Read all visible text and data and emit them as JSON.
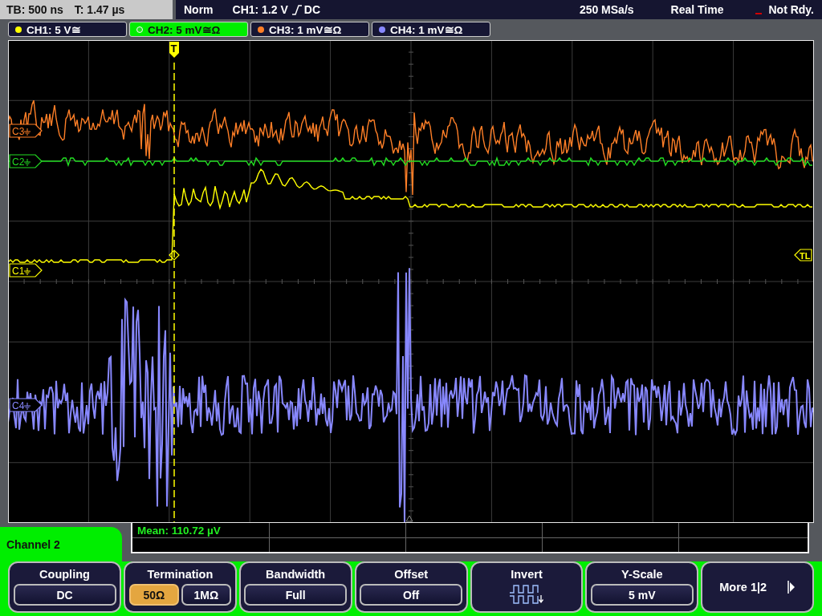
{
  "status_bar": {
    "timebase": "TB: 500 ns",
    "trigger_time": "T: 1.47 µs",
    "trigger_mode": "Norm",
    "trigger_source": "CH1: 1.2 V",
    "trigger_coupling": "DC",
    "sample_rate": "250 MSa/s",
    "acquisition": "Real Time",
    "state": "Not Rdy."
  },
  "channels": [
    {
      "label": "CH1: 5 V≅",
      "color": "#ffff00",
      "selected": false
    },
    {
      "label": "CH2: 5 mV≅Ω",
      "color": "#22dd22",
      "selected": true
    },
    {
      "label": "CH3: 1 mV≅Ω",
      "color": "#ff7f27",
      "selected": false
    },
    {
      "label": "CH4: 1 mV≅Ω",
      "color": "#8888ff",
      "selected": false
    }
  ],
  "traces": [
    {
      "marker": "C3",
      "color": "#ff7f27"
    },
    {
      "marker": "C2",
      "color": "#22dd22"
    },
    {
      "marker": "C1",
      "color": "#ffff00"
    },
    {
      "marker": "C4",
      "color": "#8888ff"
    }
  ],
  "trigger": {
    "position_marker": "T",
    "level_marker": "TL"
  },
  "measurement": {
    "text": "Mean: 110.72 µV"
  },
  "menu": {
    "title": "Channel 2",
    "buttons": [
      {
        "kind": "value",
        "label": "Coupling",
        "value": "DC"
      },
      {
        "kind": "choice",
        "label": "Termination",
        "options": [
          {
            "label": "50Ω",
            "selected": true
          },
          {
            "label": "1MΩ",
            "selected": false
          }
        ]
      },
      {
        "kind": "value",
        "label": "Bandwidth",
        "value": "Full"
      },
      {
        "kind": "value",
        "label": "Offset",
        "value": "Off"
      },
      {
        "kind": "icon",
        "label": "Invert"
      },
      {
        "kind": "value",
        "label": "Y-Scale",
        "value": "5 mV"
      },
      {
        "kind": "next",
        "label": "More 1|2"
      }
    ]
  }
}
